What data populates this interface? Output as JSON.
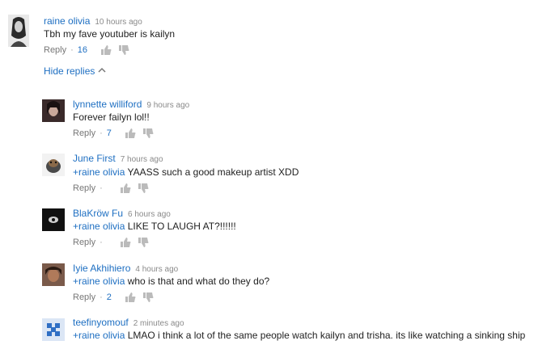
{
  "top_comment": {
    "author": "raine olivia",
    "time": "10 hours ago",
    "text": "Tbh my fave youtuber is kailyn",
    "reply_label": "Reply",
    "likes": "16"
  },
  "hide_replies_label": "Hide replies",
  "replies": [
    {
      "author": "lynnette williford",
      "time": "9 hours ago",
      "mention": "",
      "text": "Forever failyn lol!!",
      "reply_label": "Reply",
      "likes": "7"
    },
    {
      "author": "June First",
      "time": "7 hours ago",
      "mention": "+raine olivia",
      "text": " YAASS such a good makeup artist XDD",
      "reply_label": "Reply",
      "likes": ""
    },
    {
      "author": "BlaKröw Fu",
      "time": "6 hours ago",
      "mention": "+raine olivia",
      "text": " LIKE TO LAUGH AT?!!!!!!",
      "reply_label": "Reply",
      "likes": ""
    },
    {
      "author": "Iyie Akhihiero",
      "time": "4 hours ago",
      "mention": "+raine olivia",
      "text": " who is that and what do they do?",
      "reply_label": "Reply",
      "likes": "2"
    },
    {
      "author": "teefinyomouf",
      "time": "2 minutes ago",
      "mention": "+raine olivia",
      "text": " LMAO i think a lot of the same people watch kailyn and trisha. its like watching  a sinking ship",
      "reply_label": "",
      "likes": ""
    }
  ]
}
